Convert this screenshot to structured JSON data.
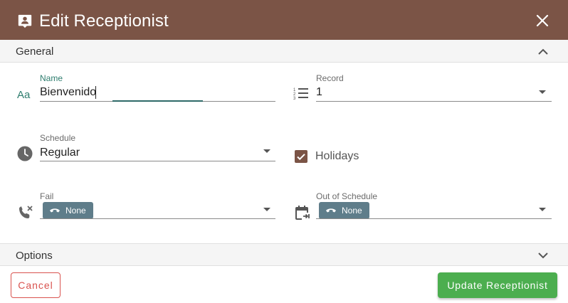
{
  "dialog": {
    "title": "Edit Receptionist",
    "header_color": "#7b5446"
  },
  "sections": {
    "general": "General",
    "options": "Options"
  },
  "fields": {
    "name": {
      "label": "Name",
      "value": "Bienvenido"
    },
    "record": {
      "label": "Record",
      "value": "1"
    },
    "schedule": {
      "label": "Schedule",
      "value": "Regular"
    },
    "holidays": {
      "label": "Holidays",
      "checked": true
    },
    "fail": {
      "label": "Fail",
      "chip": "None"
    },
    "out_of_schedule": {
      "label": "Out of Schedule",
      "chip": "None"
    }
  },
  "buttons": {
    "cancel": "Cancel",
    "update": "Update Receptionist"
  },
  "colors": {
    "accent": "#7b5446",
    "chip": "#5f7d8a",
    "cancel": "#d9534f",
    "update": "#4cae4f",
    "focus": "#2e6a68"
  },
  "icons": {
    "header": "receptionist-icon",
    "close": "close-icon",
    "name": "text-format-icon",
    "record": "numbered-list-icon",
    "schedule": "clock-icon",
    "fail": "phone-missed-icon",
    "out_of_schedule": "calendar-arrow-icon",
    "chip": "hangup-icon"
  }
}
